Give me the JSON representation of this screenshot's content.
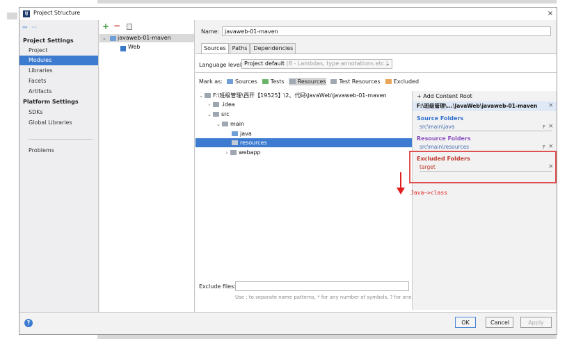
{
  "window": {
    "title": "Project Structure",
    "close_glyph": "×",
    "app_icon_text": "IJ"
  },
  "nav": {
    "back": "⇦",
    "forward": "⇨"
  },
  "left_panel": {
    "project_settings_header": "Project Settings",
    "project_items": [
      "Project",
      "Modules",
      "Libraries",
      "Facets",
      "Artifacts"
    ],
    "platform_settings_header": "Platform Settings",
    "platform_items": [
      "SDKs",
      "Global Libraries"
    ],
    "problems": "Problems",
    "selected": "Modules"
  },
  "middle_panel": {
    "add": "+",
    "remove": "−",
    "module_name": "javaweb-01-maven",
    "module_chevron": "⌄",
    "child": "Web"
  },
  "right_panel": {
    "name_label": "Name:",
    "name_value": "javaweb-01-maven",
    "tabs": [
      "Sources",
      "Paths",
      "Dependencies"
    ],
    "active_tab": "Sources",
    "language_level_label": "Language level:",
    "language_level_value": "Project default",
    "language_level_hint": "(8 - Lambdas, type annotations etc.)",
    "dropdown_arrow": "⌄",
    "mark_as_label": "Mark as:",
    "mark_as_options": [
      {
        "label": "Sources",
        "color": "#6e9fd8"
      },
      {
        "label": "Tests",
        "color": "#6ab46a"
      },
      {
        "label": "Resources",
        "color": "#a0a8b4"
      },
      {
        "label": "Test Resources",
        "color": "#a0a8b4"
      },
      {
        "label": "Excluded",
        "color": "#e8a55a"
      }
    ],
    "tree": [
      {
        "chevron": "⌄",
        "label": "F:\\班级管理\\西开【19525】\\2、代码\\JavaWeb\\javaweb-01-maven"
      },
      {
        "chevron": "›",
        "label": ".idea"
      },
      {
        "chevron": "⌄",
        "label": "src"
      },
      {
        "chevron": "⌄",
        "label": "main"
      },
      {
        "chevron": "",
        "label": "java"
      },
      {
        "chevron": "",
        "label": "resources"
      },
      {
        "chevron": "›",
        "label": "webapp"
      }
    ],
    "selected_tree_item": "resources",
    "exclude_files_label": "Exclude files:",
    "exclude_files_value": "",
    "exclude_hint": "Use ; to separate name patterns, * for any number of symbols, ? for one."
  },
  "content_roots": {
    "add_content_root": "+ Add Content Root",
    "root_path": "F:\\班级管理\\...\\JavaWeb\\javaweb-01-maven",
    "remove_glyph": "×",
    "edit_glyph": "F",
    "source_folders_header": "Source Folders",
    "source_folders": [
      "src\\main\\java"
    ],
    "source_color": "#2f6fd0",
    "resource_folders_header": "Resource Folders",
    "resource_folders": [
      "src\\main\\resources"
    ],
    "resource_color": "#8a4fc0",
    "excluded_folders_header": "Excluded Folders",
    "excluded_folders": [
      "target"
    ],
    "excluded_color": "#c0392b"
  },
  "annotation": {
    "text": "Java—>class",
    "color": "#e02020"
  },
  "buttons": {
    "ok": "OK",
    "cancel": "Cancel",
    "apply": "Apply",
    "help": "?"
  }
}
